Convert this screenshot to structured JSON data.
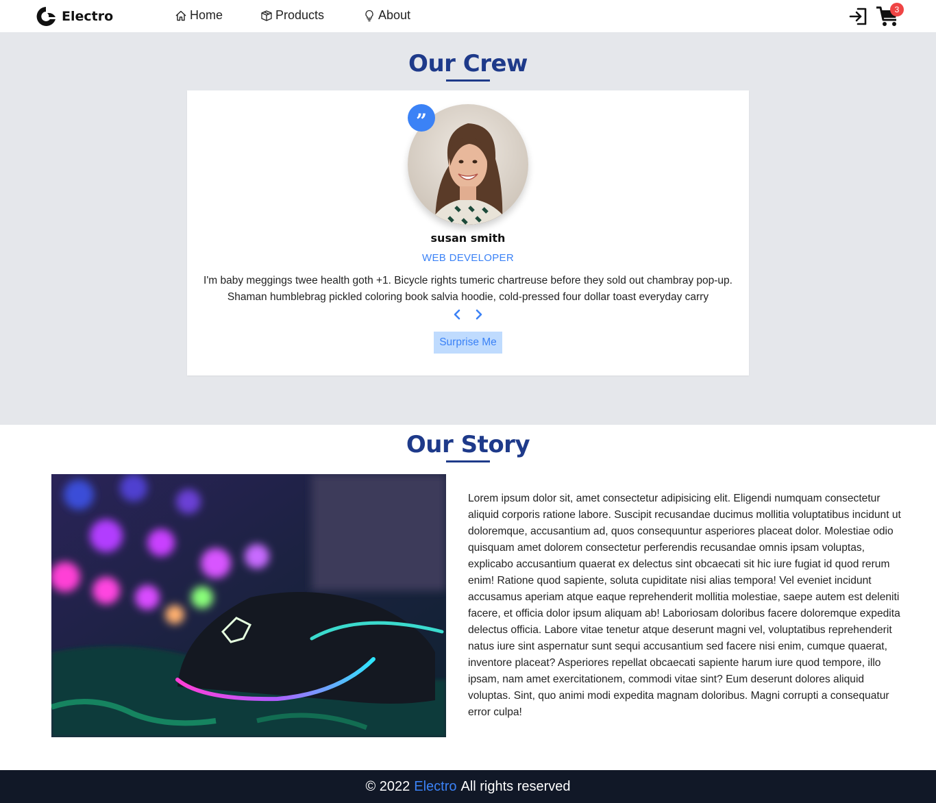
{
  "navbar": {
    "brand": "Electro",
    "links": [
      {
        "label": "Home",
        "icon": "home-icon"
      },
      {
        "label": "Products",
        "icon": "box-icon"
      },
      {
        "label": "About",
        "icon": "lightbulb-icon"
      }
    ],
    "login_icon": "login-icon",
    "cart_icon": "cart-icon",
    "cart_count": "3"
  },
  "crew": {
    "title": "Our Crew",
    "person": {
      "name": "susan smith",
      "job": "web developer",
      "text": "I'm baby meggings twee health goth +1. Bicycle rights tumeric chartreuse before they sold out chambray pop-up. Shaman humblebrag pickled coloring book salvia hoodie, cold-pressed four dollar toast everyday carry"
    },
    "quote_icon": "quote-icon",
    "prev_icon": "chevron-left-icon",
    "next_icon": "chevron-right-icon",
    "surprise_label": "Surprise Me"
  },
  "story": {
    "title": "Our Story",
    "image": "gaming-mouse-photo",
    "text": "Lorem ipsum dolor sit, amet consectetur adipisicing elit. Eligendi numquam consectetur aliquid corporis ratione labore. Suscipit recusandae ducimus mollitia voluptatibus incidunt ut doloremque, accusantium ad, quos consequuntur asperiores placeat dolor. Molestiae odio quisquam amet dolorem consectetur perferendis recusandae omnis ipsam voluptas, explicabo accusantium quaerat ex delectus sint obcaecati sit hic iure fugiat id quod rerum enim! Ratione quod sapiente, soluta cupiditate nisi alias tempora! Vel eveniet incidunt accusamus aperiam atque eaque reprehenderit mollitia molestiae, saepe autem est deleniti facere, et officia dolor ipsum aliquam ab! Laboriosam doloribus facere doloremque expedita delectus officia. Labore vitae tenetur atque deserunt magni vel, voluptatibus reprehenderit natus iure sint aspernatur sunt sequi accusantium sed facere nisi enim, cumque quaerat, inventore placeat? Asperiores repellat obcaecati sapiente harum iure quod tempore, illo ipsam, nam amet exercitationem, commodi vitae sint? Eum deserunt dolores aliquid voluptas. Sint, quo animi modi expedita magnam doloribus. Magni corrupti a consequatur error culpa!"
  },
  "footer": {
    "prefix": "© 2022",
    "brand": "Electro",
    "suffix": "All rights reserved"
  },
  "colors": {
    "primary_dark": "#1e3a8a",
    "accent": "#3b82f6",
    "section_bg": "#e5e7eb",
    "footer_bg": "#111827",
    "badge": "#ef4444"
  }
}
